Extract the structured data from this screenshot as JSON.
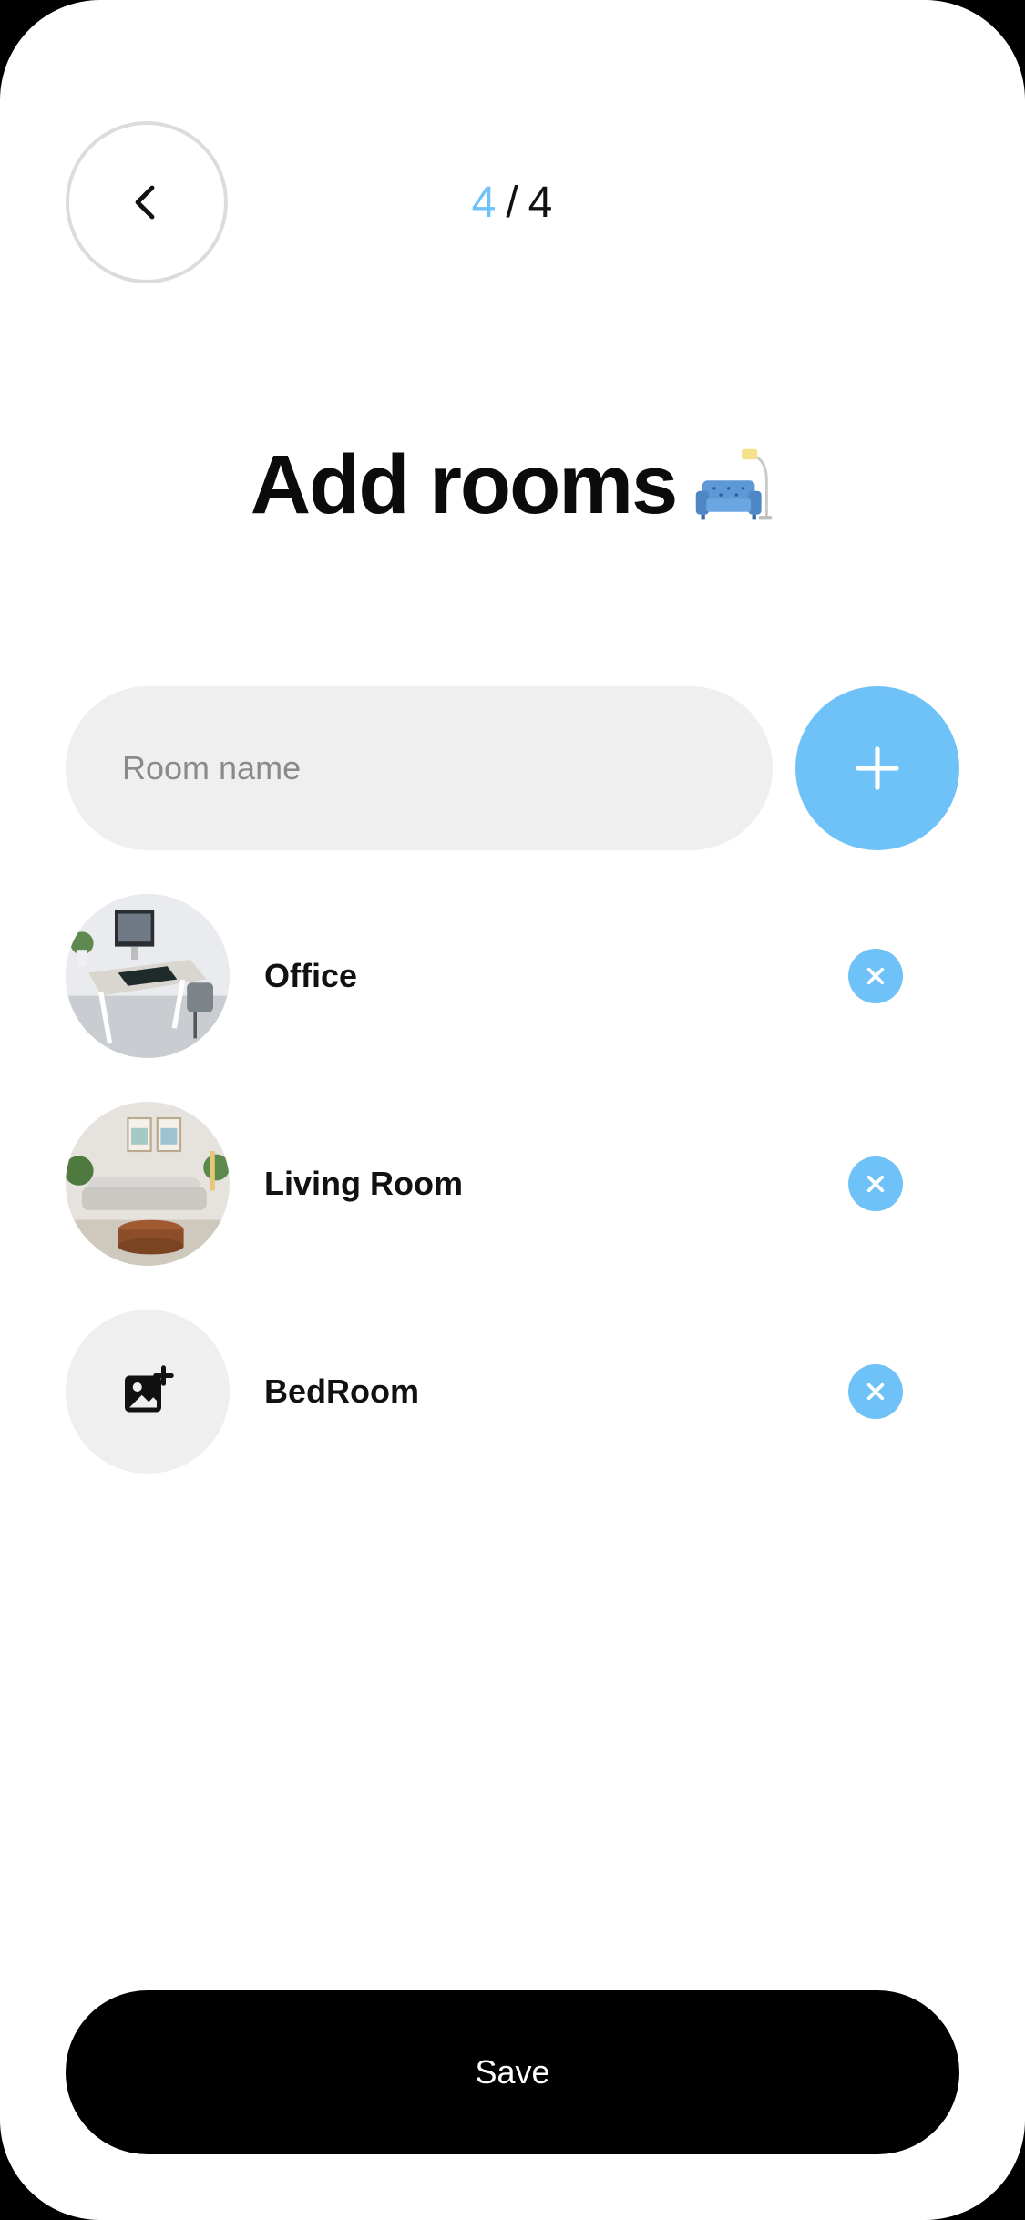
{
  "header": {
    "back_icon": "chevron-left-icon",
    "step_current": "4",
    "step_separator": "/",
    "step_total": "4"
  },
  "title": {
    "text": "Add rooms",
    "emoji_icon": "couch-and-lamp-icon"
  },
  "room_input": {
    "value": "",
    "placeholder": "Room name",
    "add_icon": "plus-icon"
  },
  "rooms": [
    {
      "name": "Office",
      "thumbnail": "office-photo",
      "remove_icon": "close-icon"
    },
    {
      "name": "Living Room",
      "thumbnail": "living-room-photo",
      "remove_icon": "close-icon"
    },
    {
      "name": "BedRoom",
      "thumbnail": "add-photo-icon",
      "remove_icon": "close-icon"
    }
  ],
  "footer": {
    "save_label": "Save"
  },
  "colors": {
    "accent": "#6ec2f7",
    "input_bg": "#efefef",
    "primary_button": "#000000",
    "text": "#111111"
  }
}
